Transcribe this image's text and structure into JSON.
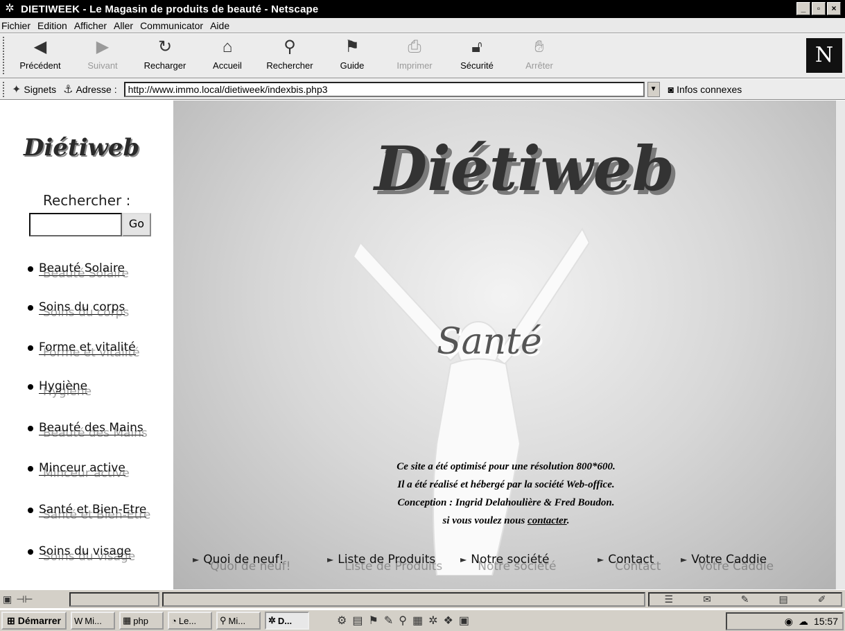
{
  "window": {
    "title": "DIETIWEEK - Le Magasin de produits de beauté - Netscape",
    "controls": [
      "_",
      "▫",
      "×"
    ]
  },
  "menubar": {
    "items": [
      "Fichier",
      "Edition",
      "Afficher",
      "Aller",
      "Communicator",
      "Aide"
    ]
  },
  "toolbar": {
    "buttons": [
      {
        "label": "Précédent",
        "icon": "back-arrow-icon",
        "enabled": true
      },
      {
        "label": "Suivant",
        "icon": "forward-arrow-icon",
        "enabled": false
      },
      {
        "label": "Recharger",
        "icon": "reload-icon",
        "enabled": true
      },
      {
        "label": "Accueil",
        "icon": "home-icon",
        "enabled": true
      },
      {
        "label": "Rechercher",
        "icon": "search-icon",
        "enabled": true
      },
      {
        "label": "Guide",
        "icon": "guide-icon",
        "enabled": true
      },
      {
        "label": "Imprimer",
        "icon": "print-icon",
        "enabled": false
      },
      {
        "label": "Sécurité",
        "icon": "lock-icon",
        "enabled": true
      },
      {
        "label": "Arrêter",
        "icon": "stop-icon",
        "enabled": false
      }
    ],
    "logo": "N"
  },
  "location": {
    "bookmarks_label": "Signets",
    "address_label": "Adresse :",
    "url": "http://www.immo.local/dietiweek/indexbis.php3",
    "infos_label": "Infos connexes"
  },
  "page": {
    "side_logo": "Diétiweb",
    "search_label": "Rechercher :",
    "search_value": "",
    "go_label": "Go",
    "nav": [
      "Beauté Solaire",
      "Soins du corps",
      "Forme et vitalité",
      "Hygiène",
      "Beauté des Mains",
      "Minceur active",
      "Santé et Bien-Etre",
      "Soins du visage"
    ],
    "hero_logo": "Diétiweb",
    "hero_word": "Santé",
    "credits": {
      "line1": "Ce site a été optimisé pour une résolution 800*600.",
      "line2": "Il a été réalisé et hébergé par la société Web-office.",
      "line3": "Conception : Ingrid Delahoulière & Fred Boudon.",
      "line4_prefix": "si vous voulez nous ",
      "contact_link": "contacter",
      "line4_suffix": "."
    },
    "bottom_nav": [
      "Quoi de neuf!",
      "Liste de Produits",
      "Notre société",
      "Contact",
      "Votre Caddie"
    ]
  },
  "statusbar": {
    "text": ""
  },
  "taskbar": {
    "start_label": "Démarrer",
    "tasks": [
      {
        "label": "Mi...",
        "active": false
      },
      {
        "label": "php",
        "active": false
      },
      {
        "label": "Le...",
        "active": false
      },
      {
        "label": "Mi...",
        "active": false
      },
      {
        "label": "D...",
        "active": true
      }
    ],
    "clock": "15:57"
  }
}
